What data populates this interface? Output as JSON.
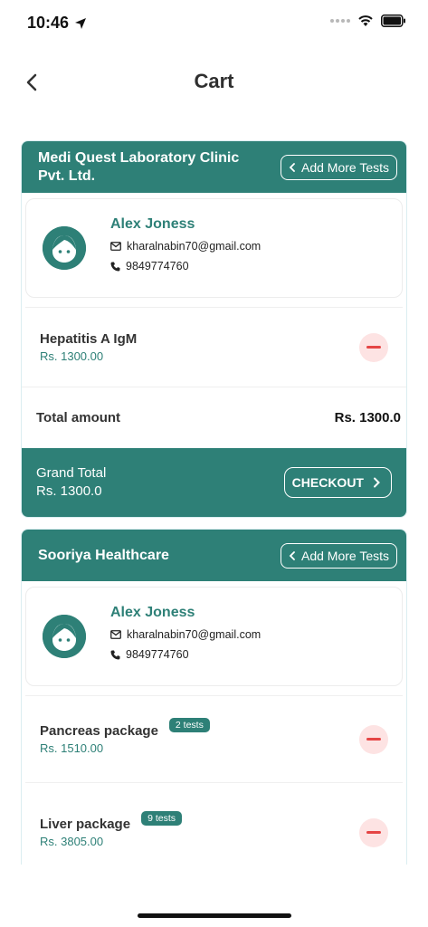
{
  "status_bar": {
    "time": "10:46"
  },
  "nav": {
    "title": "Cart"
  },
  "labs": [
    {
      "name": "Medi Quest Laboratory Clinic Pvt. Ltd.",
      "add_more_label": "Add More Tests",
      "patient": {
        "name": "Alex Joness",
        "email": "kharalnabin70@gmail.com",
        "phone": "9849774760"
      },
      "tests": [
        {
          "name": "Hepatitis A IgM",
          "price": "Rs. 1300.00"
        }
      ],
      "total_label": "Total amount",
      "total_value": "Rs. 1300.0",
      "grand_total_label": "Grand Total",
      "grand_total_value": "Rs. 1300.0",
      "checkout_label": "CHECKOUT"
    },
    {
      "name": "Sooriya Healthcare",
      "add_more_label": "Add More Tests",
      "patient": {
        "name": "Alex Joness",
        "email": "kharalnabin70@gmail.com",
        "phone": "9849774760"
      },
      "tests": [
        {
          "name": "Pancreas package",
          "badge": "2 tests",
          "price": "Rs. 1510.00"
        },
        {
          "name": "Liver package",
          "badge": "9 tests",
          "price": "Rs. 3805.00"
        }
      ]
    }
  ],
  "colors": {
    "primary": "#2e8077",
    "remove_bg": "#fde3e3",
    "remove_icon": "#e54545"
  },
  "icons": [
    "location-arrow-icon",
    "signal-icon",
    "wifi-icon",
    "battery-icon",
    "back-chevron-icon",
    "chevron-left-icon",
    "mail-icon",
    "phone-icon",
    "minus-icon",
    "chevron-right-icon",
    "avatar-face-icon"
  ]
}
